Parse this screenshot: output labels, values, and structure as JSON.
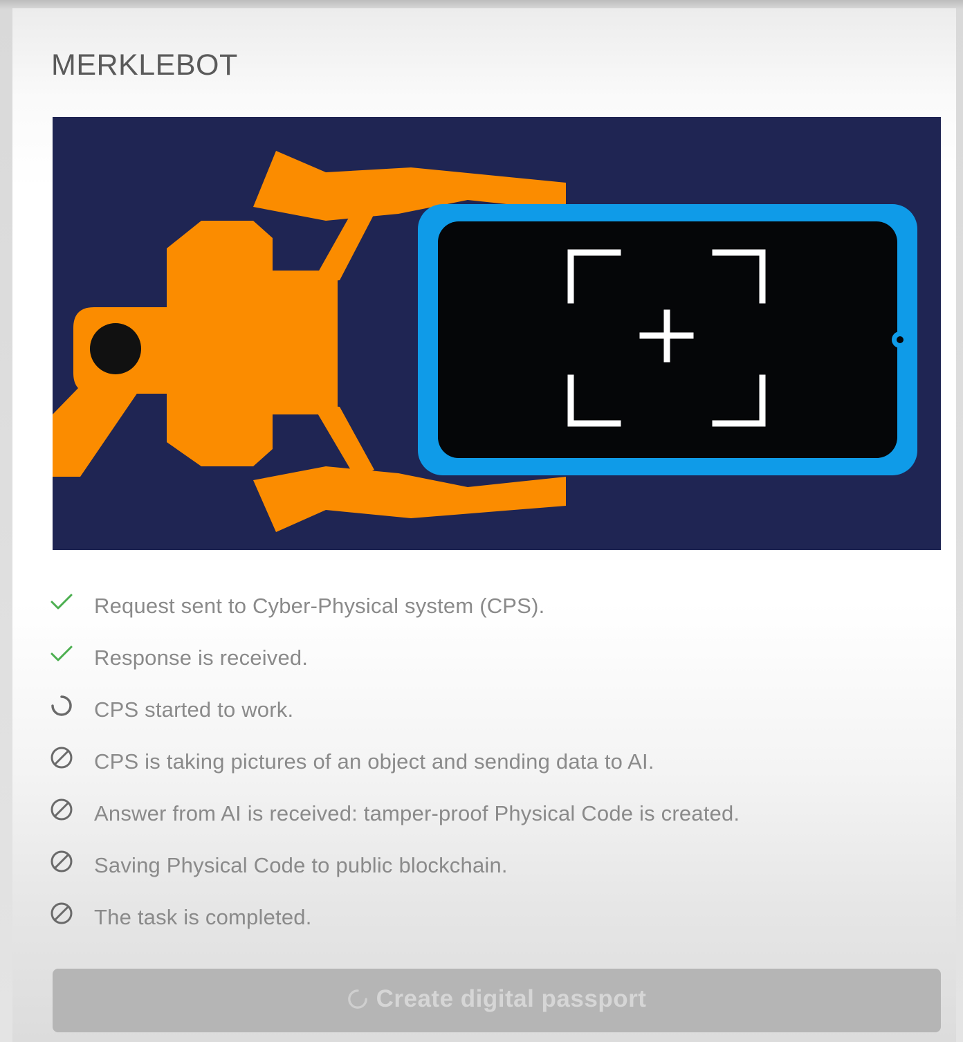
{
  "app": {
    "title": "MERKLEBOT"
  },
  "hero": {
    "image": "robot-arm-holding-phone-scanner-illustration",
    "colors": {
      "background": "#1f2553",
      "arm": "#fb8c00",
      "phone_frame": "#0f9be8",
      "screen": "#050608",
      "reticle": "#ffffff"
    }
  },
  "steps": [
    {
      "label": "Request sent to Cyber-Physical system (CPS).",
      "status": "done",
      "icon": "check-icon"
    },
    {
      "label": "Response is received.",
      "status": "done",
      "icon": "check-icon"
    },
    {
      "label": "CPS started to work.",
      "status": "in-progress",
      "icon": "spinner-icon"
    },
    {
      "label": "CPS is taking pictures of an object and sending data to AI.",
      "status": "pending",
      "icon": "blocked-icon"
    },
    {
      "label": "Answer from AI is received: tamper-proof Physical Code is created.",
      "status": "pending",
      "icon": "blocked-icon"
    },
    {
      "label": "Saving Physical Code to public blockchain.",
      "status": "pending",
      "icon": "blocked-icon"
    },
    {
      "label": "The task is completed.",
      "status": "pending",
      "icon": "blocked-icon"
    }
  ],
  "action": {
    "label": "Create digital passport",
    "state": "disabled-loading",
    "icon": "spinner-icon"
  },
  "colors": {
    "done": "#4caf50",
    "icon_gray": "#6a6a6a",
    "text": "#8a8a8a",
    "title": "#5a5a5a",
    "button_bg": "#b5b5b5",
    "button_text": "#d6d6d6"
  }
}
